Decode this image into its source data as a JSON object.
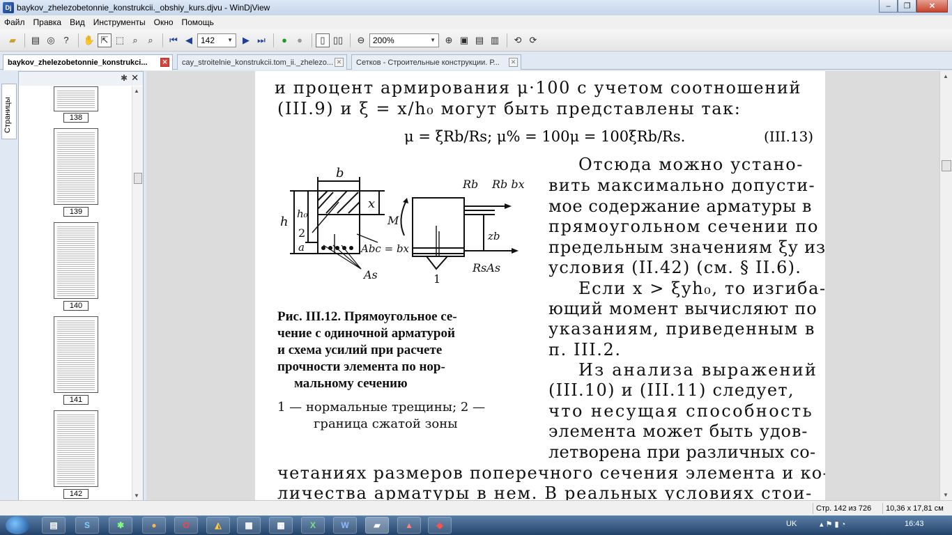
{
  "window": {
    "title": "baykov_zhelezobetonnie_konstrukcii._obshiy_kurs.djvu - WinDjView",
    "buttons": [
      "–",
      "❐",
      "✕"
    ]
  },
  "menu": [
    "Файл",
    "Правка",
    "Вид",
    "Инструменты",
    "Окно",
    "Помощь"
  ],
  "toolbar": {
    "page_value": "142",
    "zoom_value": "200%"
  },
  "tabs": [
    {
      "label": "baykov_zhelezobetonnie_konstrukci...",
      "active": true
    },
    {
      "label": "cay_stroitelnie_konstrukcii.tom_ii._zhelezo...",
      "active": false
    },
    {
      "label": "Сетков - Строительные конструкции. Р...",
      "active": false
    }
  ],
  "sidebar": {
    "tab_label": "Страницы",
    "pages": [
      "138",
      "139",
      "140",
      "141",
      "142"
    ]
  },
  "page": {
    "lines": [
      "и процент армирования μ·100 с учетом соотношений",
      "(III.9) и ξ = x/h₀ могут быть представлены так:"
    ],
    "formula": "μ = ξRb/Rs;   μ% = 100μ = 100ξRb/Rs.",
    "eq_number": "(III.13)",
    "right_lines": [
      "Отсюда можно устано-",
      "вить максимально допусти-",
      "мое содержание арматуры в",
      "прямоугольном сечении по",
      "предельным значениям ξy из",
      "условия (II.42) (см. § II.6).",
      "Если x > ξyh₀, то изгиба-",
      "ющий момент вычисляют по",
      "указаниям, приведенным в",
      "п. III.2.",
      "Из анализа выражений",
      "(III.10) и (III.11) следует,",
      "что несущая способность",
      "элемента может быть удов-",
      "летворена при различных со-"
    ],
    "bottom_lines": [
      "четаниях размеров поперечного сечения элемента и ко-",
      "личества арматуры в нем. В реальных условиях стои-"
    ],
    "figure": {
      "labels": {
        "b": "b",
        "x": "x",
        "h": "h",
        "h0": "h₀",
        "a": "a",
        "n2": "2",
        "n1": "1",
        "Abc": "Abc = bx",
        "As": "As",
        "M": "M",
        "Rb": "Rb",
        "Rbbx": "Rb bx",
        "zb": "zb",
        "RsAs": "RsAs"
      },
      "caption": [
        "Рис. III.12. Прямоугольное се-",
        "чение с одиночной арматурой",
        "и схема усилий при расчете",
        "прочности элемента по нор-",
        "мальному сечению"
      ],
      "legend": [
        "1 — нормальные трещины; 2 —",
        "граница сжатой зоны"
      ]
    }
  },
  "status": {
    "page_info": "Стр. 142 из 726",
    "size_info": "10,36 x 17,81 см"
  },
  "taskbar": {
    "lang": "UK",
    "time": "16:43"
  }
}
